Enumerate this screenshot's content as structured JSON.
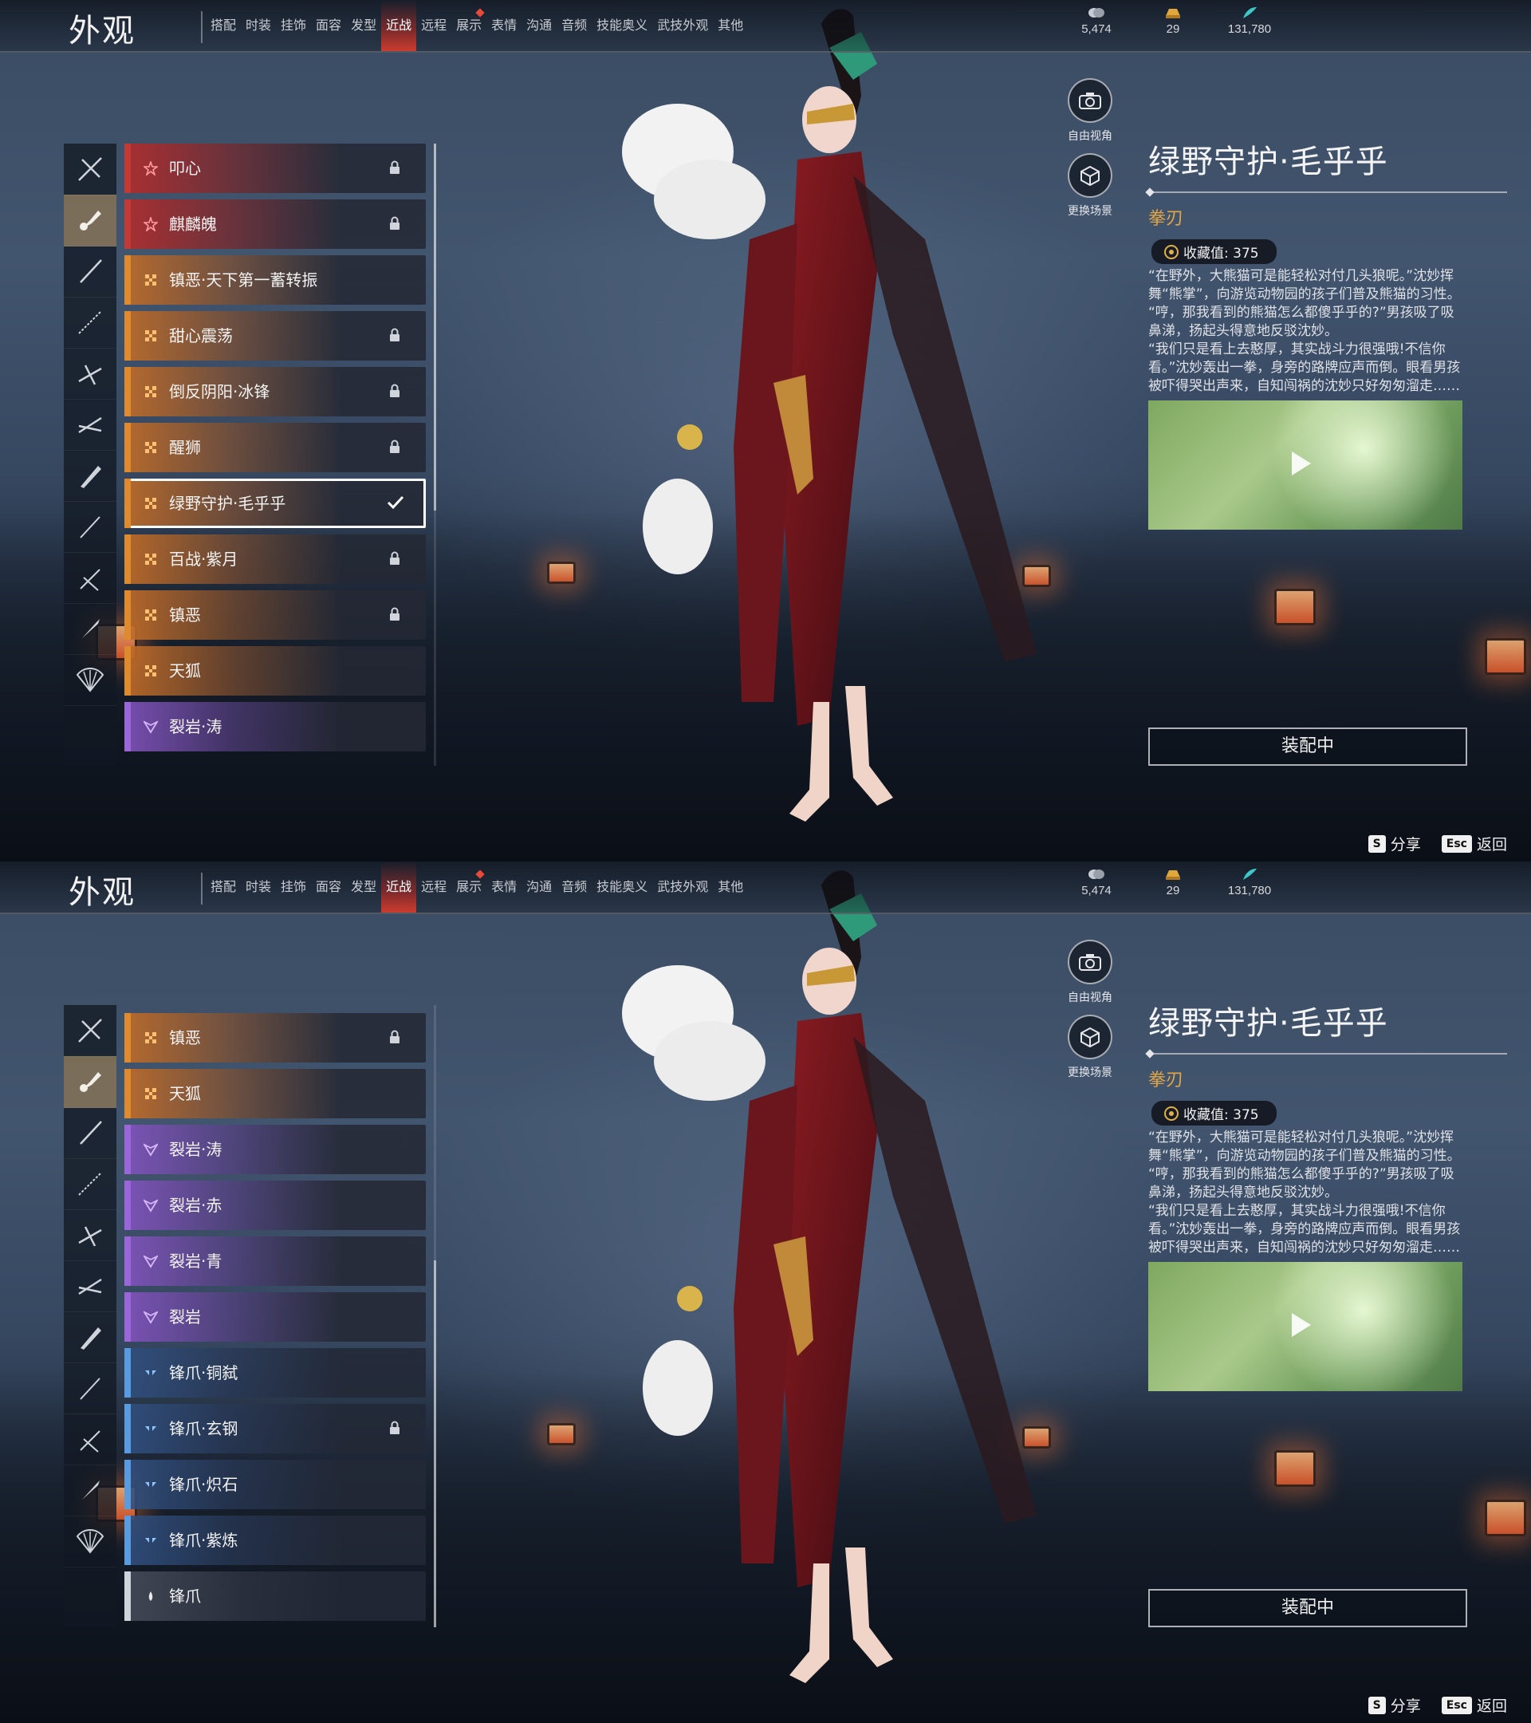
{
  "screens": [
    {
      "header": {
        "title": "外观",
        "tabs": [
          {
            "label": "搭配"
          },
          {
            "label": "时装"
          },
          {
            "label": "挂饰"
          },
          {
            "label": "面容"
          },
          {
            "label": "发型"
          },
          {
            "label": "近战",
            "active": true
          },
          {
            "label": "远程"
          },
          {
            "label": "展示",
            "dot": true
          },
          {
            "label": "表情"
          },
          {
            "label": "沟通"
          },
          {
            "label": "音频"
          },
          {
            "label": "技能奥义"
          },
          {
            "label": "武技外观"
          },
          {
            "label": "其他"
          }
        ],
        "currencies": [
          {
            "icon": "coin-icon",
            "value": "5,474"
          },
          {
            "icon": "ingot-icon",
            "value": "29"
          },
          {
            "icon": "feather-icon",
            "value": "131,780"
          }
        ]
      },
      "weapon_categories": {
        "active_index": 1,
        "icons": [
          "crossed-spear-icon",
          "fist-blade-icon",
          "sword-icon",
          "long-spear-icon",
          "glaive-icon",
          "dual-blades-icon",
          "broadsword-icon",
          "staff-icon",
          "twin-swords-icon",
          "dagger-icon",
          "fan-icon"
        ]
      },
      "items": [
        {
          "name": "叩心",
          "rarity": "red",
          "locked": true
        },
        {
          "name": "麒麟魄",
          "rarity": "red",
          "locked": true
        },
        {
          "name": "镇恶·天下第一蓄转振",
          "rarity": "orange",
          "locked": false
        },
        {
          "name": "甜心震荡",
          "rarity": "orange",
          "locked": true
        },
        {
          "name": "倒反阴阳·冰锋",
          "rarity": "orange",
          "locked": true
        },
        {
          "name": "醒狮",
          "rarity": "orange",
          "locked": true
        },
        {
          "name": "绿野守护·毛乎乎",
          "rarity": "orange",
          "locked": false,
          "selected": true
        },
        {
          "name": "百战·紫月",
          "rarity": "orange",
          "locked": true
        },
        {
          "name": "镇恶",
          "rarity": "orange",
          "locked": true
        },
        {
          "name": "天狐",
          "rarity": "orange",
          "locked": false
        },
        {
          "name": "裂岩·涛",
          "rarity": "purple",
          "locked": false
        }
      ],
      "scroll_fraction": 0.0,
      "side_buttons": [
        {
          "label": "自由视角",
          "icon": "camera-icon"
        },
        {
          "label": "更换场景",
          "icon": "scene-cube-icon"
        }
      ],
      "detail": {
        "title": "绿野守护·毛乎乎",
        "category": "拳刃",
        "collection_label": "收藏值: 375",
        "description": "“在野外，大熊猫可是能轻松对付几头狼呢。”沈妙挥舞“熊掌”，向游览动物园的孩子们普及熊猫的习性。\n“哼，那我看到的熊猫怎么都傻乎乎的?”男孩吸了吸鼻涕，扬起头得意地反驳沈妙。\n“我们只是看上去憨厚，其实战斗力很强哦!不信你看。”沈妙轰出一拳，身旁的路牌应声而倒。眼看男孩被吓得哭出声来，自知闯祸的沈妙只好匆匆溜走……",
        "equip_label": "装配中"
      },
      "hints": [
        {
          "key": "S",
          "label": "分享"
        },
        {
          "key": "Esc",
          "label": "返回"
        }
      ],
      "colors": {
        "accent_active_tab": "#d83a2a",
        "gold": "#e1a648"
      }
    },
    {
      "header": {
        "title": "外观",
        "tabs": [
          {
            "label": "搭配"
          },
          {
            "label": "时装"
          },
          {
            "label": "挂饰"
          },
          {
            "label": "面容"
          },
          {
            "label": "发型"
          },
          {
            "label": "近战",
            "active": true
          },
          {
            "label": "远程"
          },
          {
            "label": "展示",
            "dot": true
          },
          {
            "label": "表情"
          },
          {
            "label": "沟通"
          },
          {
            "label": "音频"
          },
          {
            "label": "技能奥义"
          },
          {
            "label": "武技外观"
          },
          {
            "label": "其他"
          }
        ],
        "currencies": [
          {
            "icon": "coin-icon",
            "value": "5,474"
          },
          {
            "icon": "ingot-icon",
            "value": "29"
          },
          {
            "icon": "feather-icon",
            "value": "131,780"
          }
        ]
      },
      "weapon_categories": {
        "active_index": 1,
        "icons": [
          "crossed-spear-icon",
          "fist-blade-icon",
          "sword-icon",
          "long-spear-icon",
          "glaive-icon",
          "dual-blades-icon",
          "broadsword-icon",
          "staff-icon",
          "twin-swords-icon",
          "dagger-icon",
          "fan-icon"
        ]
      },
      "items": [
        {
          "name": "镇恶",
          "rarity": "orange",
          "locked": true
        },
        {
          "name": "天狐",
          "rarity": "orange",
          "locked": false
        },
        {
          "name": "裂岩·涛",
          "rarity": "purple",
          "locked": false
        },
        {
          "name": "裂岩·赤",
          "rarity": "purple",
          "locked": false
        },
        {
          "name": "裂岩·青",
          "rarity": "purple",
          "locked": false
        },
        {
          "name": "裂岩",
          "rarity": "purple",
          "locked": false
        },
        {
          "name": "锋爪·铜弑",
          "rarity": "blue",
          "locked": false
        },
        {
          "name": "锋爪·玄钢",
          "rarity": "blue",
          "locked": true
        },
        {
          "name": "锋爪·炽石",
          "rarity": "blue",
          "locked": false
        },
        {
          "name": "锋爪·紫炼",
          "rarity": "blue",
          "locked": false
        },
        {
          "name": "锋爪",
          "rarity": "white",
          "locked": false
        }
      ],
      "scroll_fraction": 1.0,
      "side_buttons": [
        {
          "label": "自由视角",
          "icon": "camera-icon"
        },
        {
          "label": "更换场景",
          "icon": "scene-cube-icon"
        }
      ],
      "detail": {
        "title": "绿野守护·毛乎乎",
        "category": "拳刃",
        "collection_label": "收藏值: 375",
        "description": "“在野外，大熊猫可是能轻松对付几头狼呢。”沈妙挥舞“熊掌”，向游览动物园的孩子们普及熊猫的习性。\n“哼，那我看到的熊猫怎么都傻乎乎的?”男孩吸了吸鼻涕，扬起头得意地反驳沈妙。\n“我们只是看上去憨厚，其实战斗力很强哦!不信你看。”沈妙轰出一拳，身旁的路牌应声而倒。眼看男孩被吓得哭出声来，自知闯祸的沈妙只好匆匆溜走……",
        "equip_label": "装配中"
      },
      "hints": [
        {
          "key": "S",
          "label": "分享"
        },
        {
          "key": "Esc",
          "label": "返回"
        }
      ],
      "colors": {
        "accent_active_tab": "#d83a2a",
        "gold": "#e1a648"
      }
    }
  ]
}
